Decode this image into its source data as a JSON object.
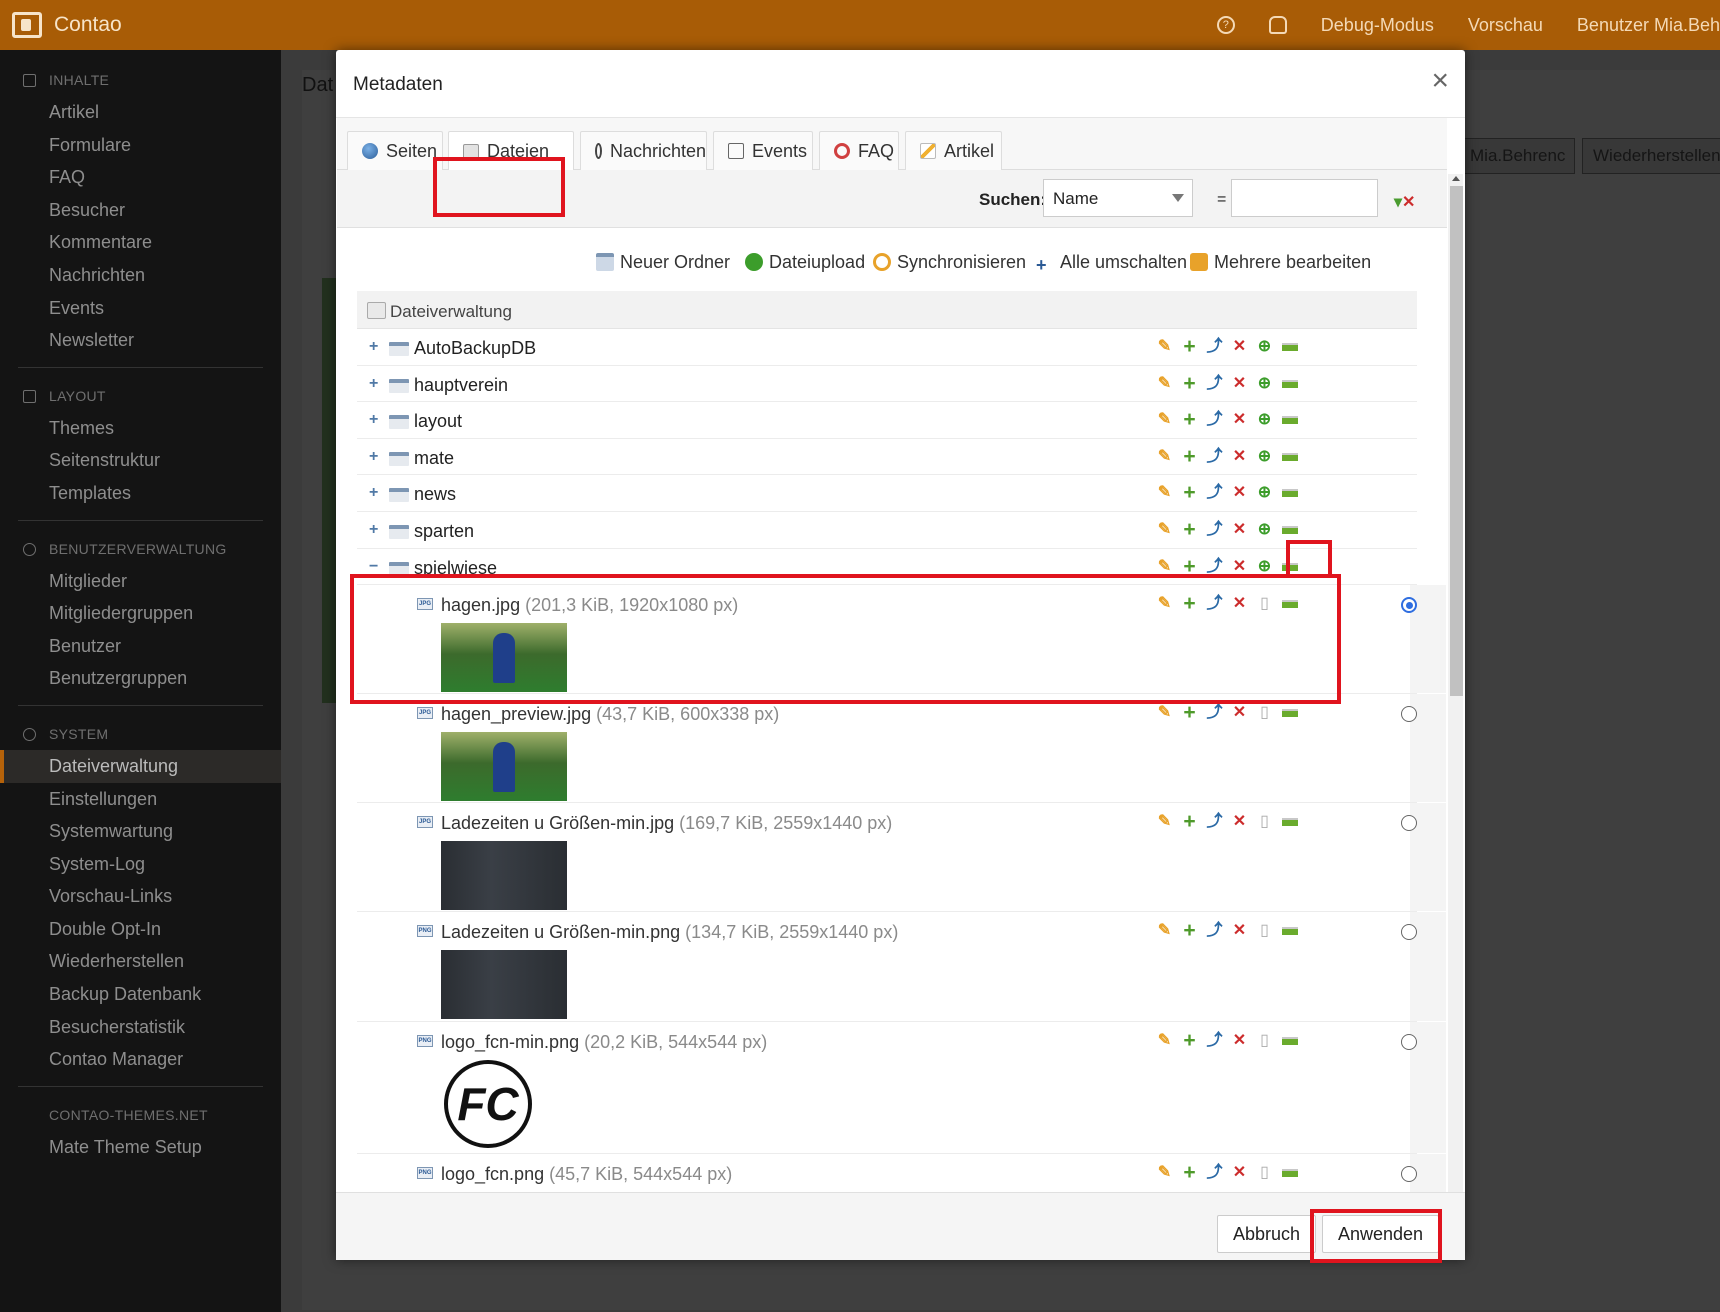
{
  "topbar": {
    "brand": "Contao",
    "help_icon": "help-circle-icon",
    "bell_icon": "bell-icon",
    "debug": "Debug-Modus",
    "preview": "Vorschau",
    "user": "Benutzer Mia.Beh",
    "color": "#a85c06"
  },
  "sidebar": {
    "sections": [
      {
        "title": "INHALTE",
        "items": [
          "Artikel",
          "Formulare",
          "FAQ",
          "Besucher",
          "Kommentare",
          "Nachrichten",
          "Events",
          "Newsletter"
        ]
      },
      {
        "title": "LAYOUT",
        "items": [
          "Themes",
          "Seitenstruktur",
          "Templates"
        ]
      },
      {
        "title": "BENUTZERVERWALTUNG",
        "items": [
          "Mitglieder",
          "Mitgliedergruppen",
          "Benutzer",
          "Benutzergruppen"
        ]
      },
      {
        "title": "SYSTEM",
        "items": [
          "Dateiverwaltung",
          "Einstellungen",
          "Systemwartung",
          "System-Log",
          "Vorschau-Links",
          "Double Opt-In",
          "Wiederherstellen",
          "Backup Datenbank",
          "Besucherstatistik",
          "Contao Manager"
        ]
      },
      {
        "title": "CONTAO-THEMES.NET",
        "items": [
          "Mate Theme Setup"
        ]
      }
    ],
    "active": "Dateiverwaltung"
  },
  "background": {
    "title": "Dat",
    "user_select": "Mia.Behrenc",
    "restore_button": "Wiederherstellen"
  },
  "modal": {
    "title": "Metadaten",
    "close": "×",
    "tabs": [
      "Seiten",
      "Dateien",
      "Nachrichten",
      "Events",
      "FAQ",
      "Artikel"
    ],
    "active_tab": "Dateien",
    "search": {
      "label": "Suchen:",
      "field": "Name",
      "equals": "=",
      "value": ""
    },
    "actions": [
      "Neuer Ordner",
      "Dateiupload",
      "Synchronisieren",
      "Alle umschalten",
      "Mehrere bearbeiten"
    ],
    "root": "Dateiverwaltung",
    "folders": [
      "AutoBackupDB",
      "hauptverein",
      "layout",
      "mate",
      "news",
      "sparten",
      "spielwiese"
    ],
    "files": [
      {
        "name": "hagen.jpg",
        "meta": "(201,3 KiB, 1920x1080 px)",
        "type": "JPG",
        "selected": true
      },
      {
        "name": "hagen_preview.jpg",
        "meta": "(43,7 KiB, 600x338 px)",
        "type": "JPG",
        "selected": false
      },
      {
        "name": "Ladezeiten u Größen-min.jpg",
        "meta": "(169,7 KiB, 2559x1440 px)",
        "type": "JPG",
        "selected": false
      },
      {
        "name": "Ladezeiten u Größen-min.png",
        "meta": "(134,7 KiB, 2559x1440 px)",
        "type": "PNG",
        "selected": false
      },
      {
        "name": "logo_fcn-min.png",
        "meta": "(20,2 KiB, 544x544 px)",
        "type": "PNG",
        "selected": false
      },
      {
        "name": "logo_fcn.png",
        "meta": "(45,7 KiB, 544x544 px)",
        "type": "PNG",
        "selected": false
      }
    ],
    "logo_text": "FC",
    "cancel": "Abbruch",
    "apply": "Anwenden"
  }
}
